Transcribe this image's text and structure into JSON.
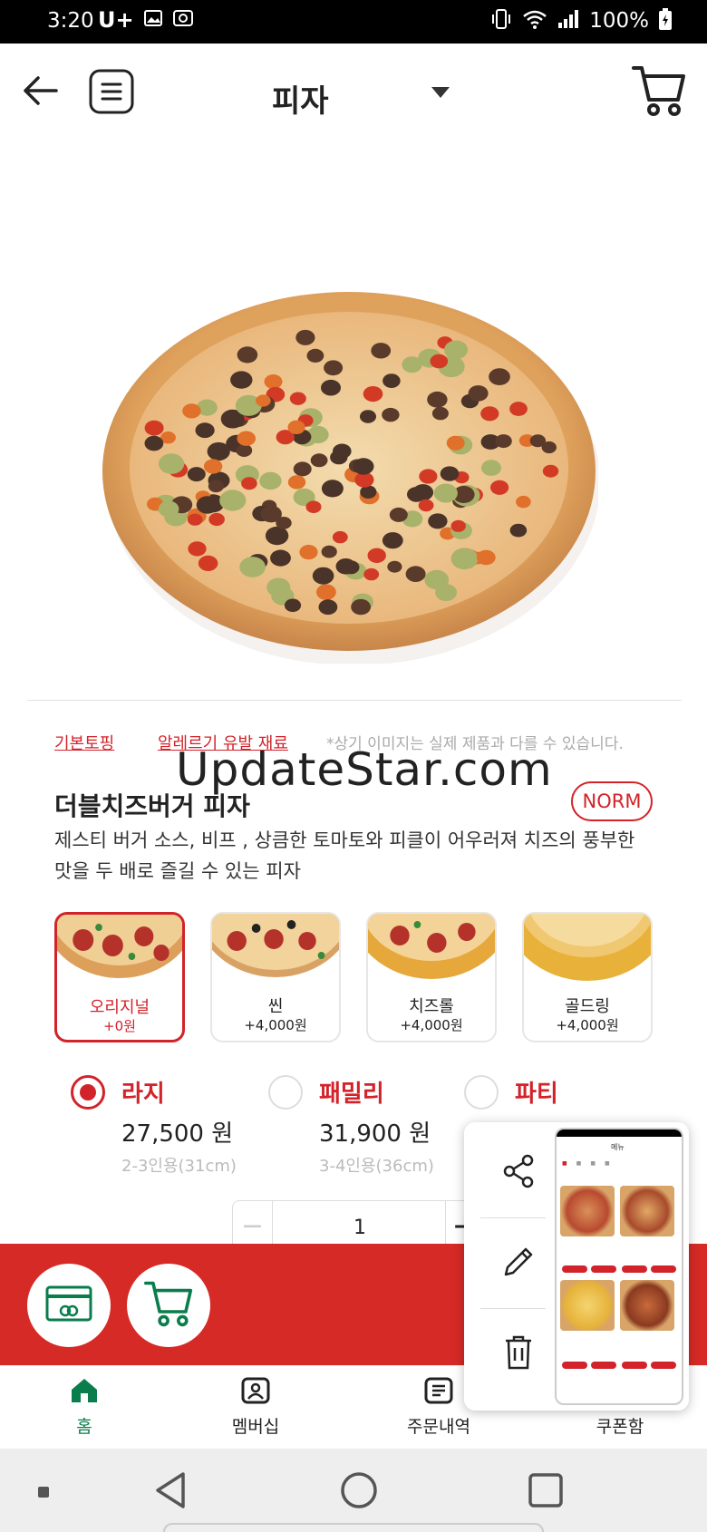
{
  "status_bar": {
    "time": "3:20",
    "carrier": "U+",
    "battery": "100%"
  },
  "header": {
    "title": "피자"
  },
  "links": {
    "basic_topping": "기본토핑",
    "allergy": "알레르기 유발 재료",
    "note": "*상기 이미지는 실제 제품과 다를 수 있습니다."
  },
  "watermark": "UpdateStar.com",
  "product": {
    "name": "더블치즈버거 피자",
    "badge": "NORM",
    "description": "제스티 버거 소스, 비프 , 상큼한 토마토와 피클이 어우러져 치즈의 풍부한 맛을 두 배로 즐길 수 있는 피자"
  },
  "crusts": [
    {
      "name": "오리지널",
      "price": "+0원",
      "selected": true
    },
    {
      "name": "씬",
      "price": "+4,000원",
      "selected": false
    },
    {
      "name": "치즈롤",
      "price": "+4,000원",
      "selected": false
    },
    {
      "name": "골드링",
      "price": "+4,000원",
      "selected": false
    }
  ],
  "sizes": [
    {
      "name": "라지",
      "price": "27,500 원",
      "desc": "2-3인용(31cm)",
      "selected": true
    },
    {
      "name": "패밀리",
      "price": "31,900 원",
      "desc": "3-4인용(36cm)",
      "selected": false
    },
    {
      "name": "파티",
      "price": "",
      "desc": "",
      "selected": false
    }
  ],
  "quantity": {
    "minus": "−",
    "value": "1",
    "plus": "+"
  },
  "bottom_nav": [
    {
      "label": "홈",
      "icon": "home-icon",
      "active": true
    },
    {
      "label": "멤버십",
      "icon": "membership-icon",
      "active": false
    },
    {
      "label": "주문내역",
      "icon": "order-history-icon",
      "active": false
    },
    {
      "label": "쿠폰함",
      "icon": "coupon-icon",
      "active": false
    }
  ],
  "popup": {
    "mini_title": "메뉴"
  },
  "colors": {
    "brand_red": "#d2232a",
    "bar_red": "#d62a26",
    "nav_green": "#0a7d4c"
  }
}
